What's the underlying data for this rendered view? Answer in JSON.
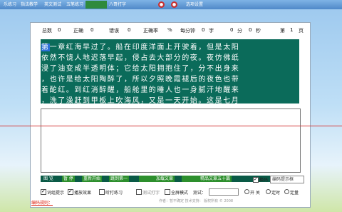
{
  "tabs": [
    "乐练习",
    "指法教学",
    "英文测试",
    "五笔练习",
    "",
    "八哥打字",
    "选项设置"
  ],
  "stats": {
    "total_label": "总数",
    "total": "0",
    "correct_label": "正确",
    "correct": "0",
    "wrong_label": "错误",
    "wrong": "0",
    "rate_label": "正确率",
    "rate_unit": "%",
    "speed_label": "每分钟",
    "speed": "0",
    "speed_unit": "字",
    "time_min": "0",
    "min_label": "分",
    "time_sec": "0",
    "sec_label": "秒",
    "page_prefix": "第",
    "page": "1",
    "page_suffix": "页"
  },
  "lines": [
    "第一章红海早过了。船在印度洋面上开驶着，但是太阳",
    "依然不饶人地迟落早起，侵占去大部分的夜。夜仿佛纸",
    "浸了油变成半透明体；它给太阳拥抱住了，分不出身来",
    "，也许是给太阳陶醉了，所以夕照晚霞褪后的夜色也带",
    "着酡红。到红消醉醒，船舱里的睡人也一身腻汗地醒来",
    "，洗了澡赶到甲板上吹海风，又是一天开始。这是七月"
  ],
  "toolbar": {
    "items": [
      "图  览",
      "暂  停",
      "重新开始",
      "跳到第一",
      "",
      "加载文章",
      "",
      "精品文章五十篇"
    ],
    "checkbox_label": "换码",
    "hint": "编码提示框"
  },
  "options": {
    "c1": "词组提示",
    "c2": "播放效果",
    "c3": "听打练习",
    "c4": "测试打字",
    "c5": "全屏模式",
    "test_label": "测试：",
    "r1": "开 关",
    "r2": "定时",
    "r3": "定量"
  },
  "footer": {
    "link": "编码规则：",
    "text": "作者：暂不确定   技术支持：   版权所有 © 2008"
  }
}
